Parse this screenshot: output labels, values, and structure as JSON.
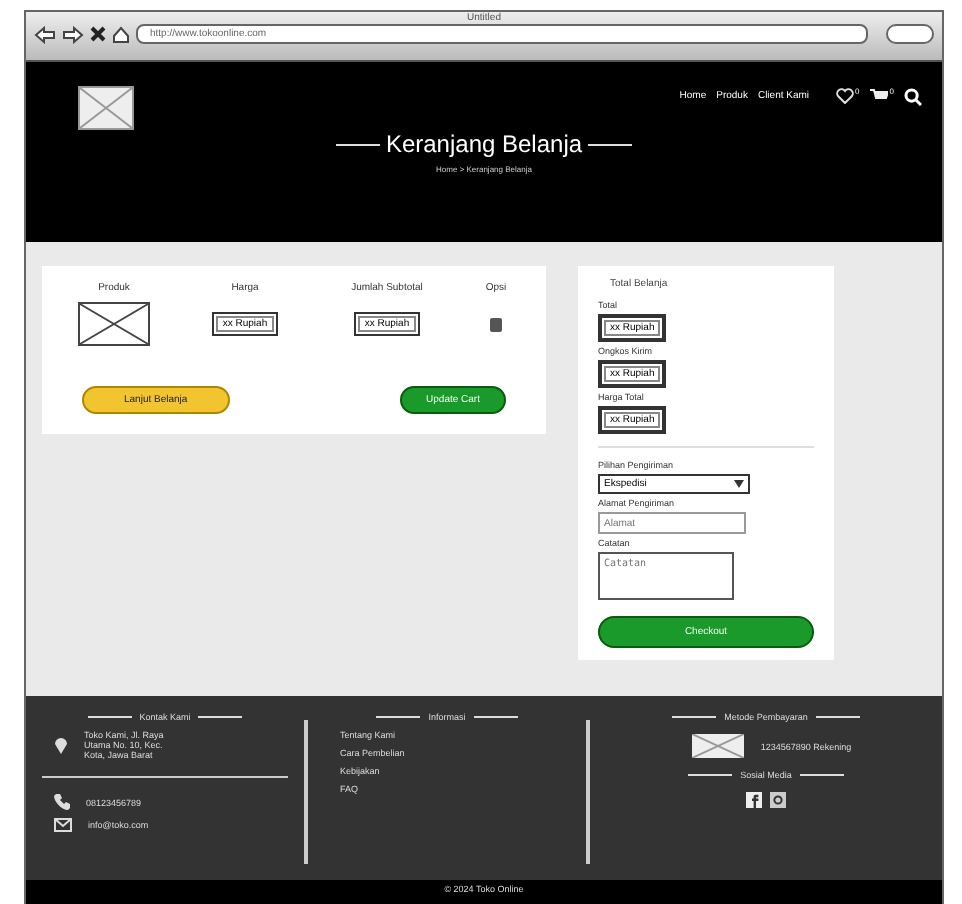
{
  "window": {
    "title": "Untitled",
    "url": "http://www.tokoonline.com"
  },
  "nav": {
    "links": [
      "Home",
      "Produk",
      "Client Kami"
    ],
    "wishlist_count": "0",
    "cart_count": "0"
  },
  "hero": {
    "title": "Keranjang Belanja",
    "breadcrumb": "Home > Keranjang Belanja"
  },
  "cart": {
    "columns": [
      "Produk",
      "Harga",
      "Jumlah Subtotal",
      "Opsi"
    ],
    "rows": [
      {
        "price": "xx Rupiah",
        "quantity": "xx Rupiah"
      }
    ],
    "buttons": [
      {
        "label": "Lanjut Belanja",
        "kind": "secondary"
      },
      {
        "label": "Update Cart",
        "kind": "primary"
      }
    ]
  },
  "summary": {
    "title": "Total Belanja",
    "fields": [
      {
        "label": "Total",
        "value": "xx Rupiah"
      },
      {
        "label": "Ongkos Kirim",
        "value": "xx Rupiah"
      },
      {
        "label": "Harga Total",
        "value": "xx Rupiah"
      }
    ],
    "shipping_label": "Pilihan Pengiriman",
    "shipping_value": "Ekspedisi",
    "address_label": "Alamat Pengiriman",
    "address_placeholder": "Alamat",
    "note_label": "Catatan",
    "note_placeholder": "Catatan",
    "checkout": "Checkout"
  },
  "footer": {
    "contact_title": "Kontak Kami",
    "address": "Toko Kami, Jl. Raya Utama No. 10, Kec. Kota, Jawa Barat",
    "phone": "08123456789",
    "email": "info@toko.com",
    "info_title": "Informasi",
    "info_links": [
      "Tentang Kami",
      "Cara Pembelian",
      "Kebijakan",
      "FAQ"
    ],
    "payment_title": "Metode Pembayaran",
    "account": "1234567890 Rekening",
    "social_title": "Sosial Media",
    "copyright": "© 2024 Toko Online"
  }
}
